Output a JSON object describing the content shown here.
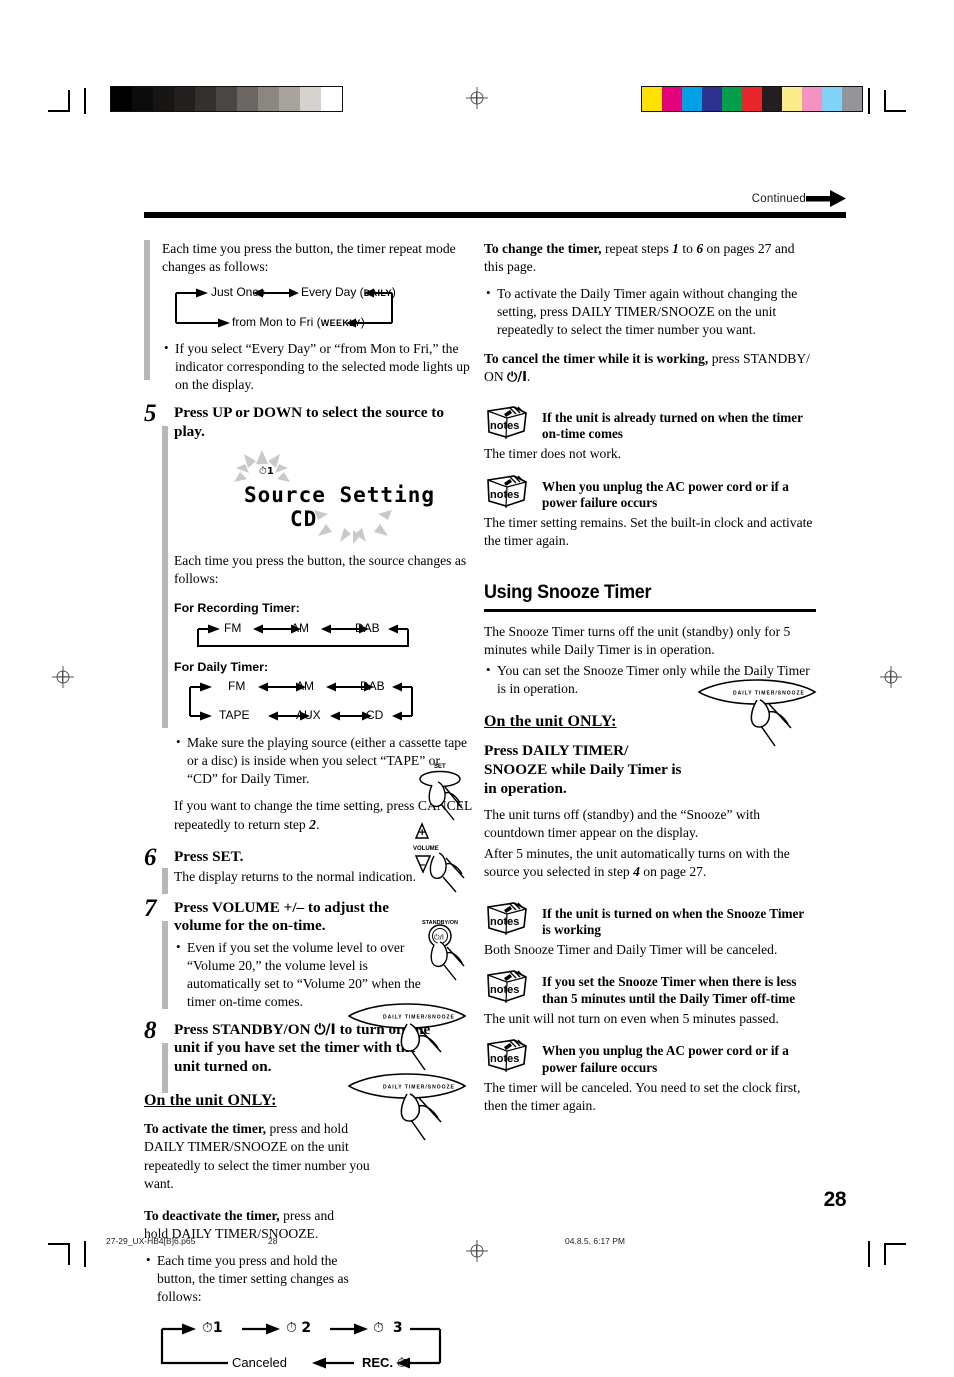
{
  "header": {
    "continued_label": "Continued",
    "page_number": "28"
  },
  "printer_marks": {
    "gray_ramp": [
      "#000000",
      "#0c0b0b",
      "#171615",
      "#221f1e",
      "#33302d",
      "#4a4643",
      "#6b6662",
      "#8b8680",
      "#a8a39d",
      "#d6d2ce",
      "#ffffff"
    ],
    "color_swatches": [
      "#fde100",
      "#e5007e",
      "#00a0e4",
      "#2e3192",
      "#00a04a",
      "#e8262b",
      "#231f20",
      "#fdec8b",
      "#f492c2",
      "#7fd4f5",
      "#939598"
    ]
  },
  "left_column": {
    "intro": {
      "line1": "Each time you press the button, the timer repeat mode",
      "line2": "changes as follows:"
    },
    "repeat_flow": {
      "just_once": "Just Once",
      "every_day": "Every Day (",
      "daily_badge": "DAILY",
      "every_day_close": ")",
      "mon_to_fri": "from Mon to Fri (",
      "weekly_badge": "WEEKLY",
      "mon_to_fri_close": ")"
    },
    "repeat_note": "If you select “Every Day” or “from Mon to Fri,” the indicator corresponding to the selected mode lights up on the display.",
    "step5": {
      "number": "5",
      "head": "Press UP or DOWN to select the source to play.",
      "display": {
        "timer_icon": "⏱",
        "timer_number": "1",
        "line1": "Source Setting",
        "line2": "CD"
      },
      "after": "Each time you press the button, the source changes as follows:",
      "rec_label": "For Recording Timer:",
      "rec_sources": [
        "FM",
        "AM",
        "DAB"
      ],
      "daily_label": "For Daily Timer:",
      "daily_sources_top": [
        "FM",
        "AM",
        "DAB"
      ],
      "daily_sources_bottom": [
        "TAPE",
        "AUX",
        "CD"
      ],
      "bullet": "Make sure the playing source (either a cassette tape or a disc) is inside when you select “TAPE” or “CD” for Daily Timer.",
      "cancel_note_a": "If you want to change the time setting, press CANCEL repeatedly to return step ",
      "cancel_note_step": "2",
      "cancel_note_b": "."
    },
    "step6": {
      "number": "6",
      "head": "Press SET.",
      "body": "The display returns to the normal indication.",
      "button_label": "SET"
    },
    "step7": {
      "number": "7",
      "head": "Press VOLUME +/– to adjust the volume for the on-time.",
      "bullet": "Even if you set the volume level to over “Volume 20,” the volume level is automatically set to “Volume 20” when the timer on-time comes.",
      "button_label": "VOLUME",
      "plus": "+",
      "minus": "–"
    },
    "step8": {
      "number": "8",
      "head_a": "Press STANDBY/ON ",
      "head_symbol": "⏻/I",
      "head_b": " to turn off the unit if you have set the timer with the unit turned on.",
      "button_label": "STANDBY/ON"
    },
    "unit_only_heading": "On the unit ONLY:",
    "activate": {
      "bold": "To activate the timer,",
      "rest": " press and hold DAILY TIMER/SNOOZE on the unit repeatedly to select the timer number you want.",
      "button_label": "DAILY TIMER/SNOOZE"
    },
    "deactivate": {
      "bold": "To deactivate the timer,",
      "rest": " press and hold DAILY TIMER/SNOOZE.",
      "button_label": "DAILY TIMER/SNOOZE"
    },
    "deactivate_bullet": "Each time you press and hold the button, the timer setting changes as follows:",
    "timer_cycle": {
      "item1": "1",
      "item2": "2",
      "item3": "3",
      "rec": "REC.",
      "canceled": "Canceled",
      "clock_icon": "⏱"
    }
  },
  "right_column": {
    "change_timer": {
      "bold": "To change the timer,",
      "mid_a": " repeat steps ",
      "step_from": "1",
      "mid_b": " to ",
      "step_to": "6",
      "mid_c": " on pages 27 and this page."
    },
    "change_bullet": "To activate the Daily Timer again without changing the setting, press DAILY TIMER/SNOOZE on the unit repeatedly to select the timer number you want.",
    "cancel_timer": {
      "bold": "To cancel the timer while it is working,",
      "rest_a": " press STANDBY/ ON ",
      "symbol": "⏻/I",
      "rest_b": "."
    },
    "notes_top": [
      {
        "icon": "notes-icon",
        "icon_label": "notes",
        "title": "If the unit is already turned on when the timer on-time comes",
        "body": "The timer does not work."
      },
      {
        "icon": "notes-icon",
        "icon_label": "notes",
        "title": "When you unplug the AC power cord or if a power failure occurs",
        "body": "The timer setting remains. Set the built-in clock and activate the timer again."
      }
    ],
    "section": {
      "title": "Using Snooze Timer",
      "intro": "The Snooze Timer turns off the unit (standby) only for 5 minutes while Daily Timer is in operation.",
      "bullet": "You can set the Snooze Timer only while the Daily Timer is in operation.",
      "unit_only_heading": "On the unit ONLY:",
      "instruction": "Press DAILY TIMER/ SNOOZE while Daily Timer is in operation.",
      "button_label": "DAILY TIMER/SNOOZE",
      "body_a": "The unit turns off (standby) and the “Snooze” with countdown timer appear on the display.",
      "body_b_a": "After 5 minutes, the unit automatically turns on with the source you selected in step ",
      "body_b_step": "4",
      "body_b_b": " on page 27."
    },
    "notes_bottom": [
      {
        "icon": "notes-icon",
        "icon_label": "notes",
        "title": "If the unit is turned on when the Snooze Timer is working",
        "body": "Both Snooze Timer and Daily Timer will be canceled."
      },
      {
        "icon": "notes-icon",
        "icon_label": "notes",
        "title": "If you set the Snooze Timer when there is less than 5 minutes until the Daily Timer off-time",
        "body": "The unit will not turn on even when 5 minutes passed."
      },
      {
        "icon": "notes-icon",
        "icon_label": "notes",
        "title": "When you unplug the AC power cord or if a power failure occurs",
        "body": "The timer will be canceled. You need to set the clock first, then the timer again."
      }
    ]
  },
  "footer": {
    "filename": "27-29_UX-HB4[B]6.p65",
    "page": "28",
    "timestamp": "04.8.5, 6:17 PM"
  }
}
